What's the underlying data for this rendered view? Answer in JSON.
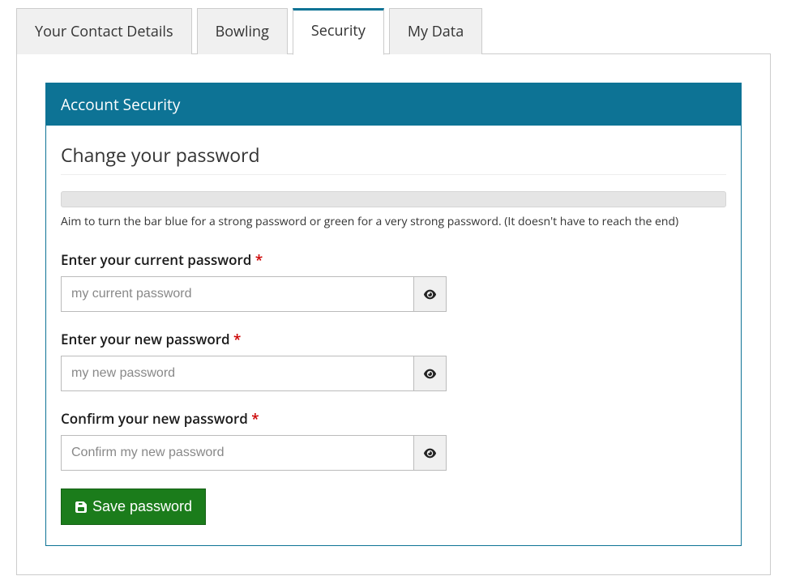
{
  "tabs": [
    {
      "label": "Your Contact Details",
      "active": false
    },
    {
      "label": "Bowling",
      "active": false
    },
    {
      "label": "Security",
      "active": true
    },
    {
      "label": "My Data",
      "active": false
    }
  ],
  "card": {
    "header": "Account Security",
    "section_title": "Change your password",
    "strength_hint": "Aim to turn the bar blue for a strong password or green for a very strong password. (It doesn't have to reach the end)"
  },
  "fields": {
    "current": {
      "label": "Enter your current password",
      "placeholder": "my current password",
      "value": ""
    },
    "new": {
      "label": "Enter your new password",
      "placeholder": "my new password",
      "value": ""
    },
    "confirm": {
      "label": "Confirm your new password",
      "placeholder": "Confirm my new password",
      "value": ""
    }
  },
  "required_marker": "*",
  "save_button_label": "Save password",
  "colors": {
    "accent": "#0d7395",
    "success": "#1b7c1b",
    "required": "#cc0000"
  }
}
